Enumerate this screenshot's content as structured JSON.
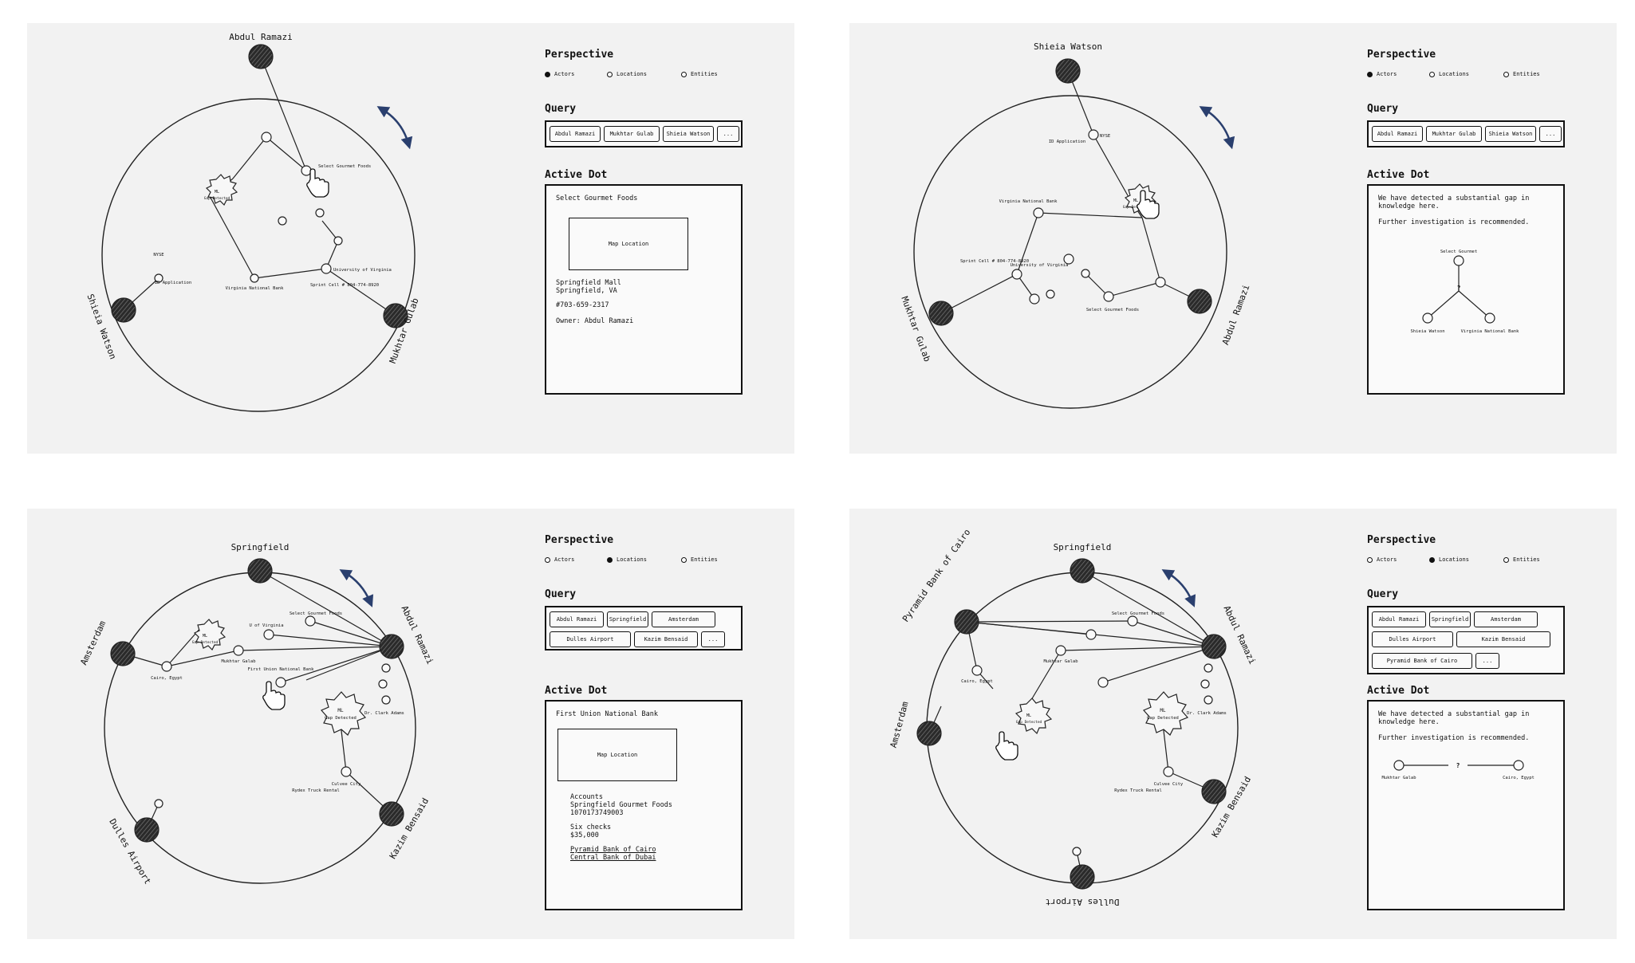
{
  "colors": {
    "panel_bg": "#f2f2f2",
    "ink": "#111111",
    "arrow": "#2a3f6e"
  },
  "labels": {
    "perspective": "Perspective",
    "query": "Query",
    "active_dot": "Active Dot",
    "map_location": "Map Location",
    "question_mark": "?",
    "gap_ml": "ML",
    "gap_text": "Gap Detected",
    "cursor_icon": "hand-pointer-icon"
  },
  "radio_options": [
    "Actors",
    "Locations",
    "Entities"
  ],
  "panels": [
    {
      "selected_perspective": "Actors",
      "query_chips": [
        "Abdul Ramazi",
        "Mukhtar Gulab",
        "Shieia Watson",
        "..."
      ],
      "outer_nodes": [
        "Abdul Ramazi",
        "Mukhtar Gulab",
        "Shieia Watson"
      ],
      "inner_labels": [
        "Select Gourmet Foods",
        "NYSE",
        "ID Application",
        "Virginia National Bank",
        "University of Virginia",
        "Sprint Cell # 804-774-8920"
      ],
      "active": {
        "title": "Select Gourmet Foods",
        "address_1": "Springfield Mall",
        "address_2": "Springfield, VA",
        "phone": "#703-659-2317",
        "owner": "Owner: Abdul Ramazi"
      }
    },
    {
      "selected_perspective": "Actors",
      "query_chips": [
        "Abdul Ramazi",
        "Mukhtar Gulab",
        "Shieia Watson",
        "..."
      ],
      "outer_nodes": [
        "Shieia Watson",
        "Abdul Ramazi",
        "Mukhtar Gulab"
      ],
      "inner_labels": [
        "NYSE",
        "ID Application",
        "Virginia National Bank",
        "Sprint Cell # 804-774-8920",
        "University of Virginia",
        "Select Gourmet Foods"
      ],
      "active": {
        "line_1": "We have detected a substantial gap in knowledge here.",
        "line_2": "Further investigation is recommended.",
        "tree_top": "Select Gourmet",
        "tree_left": "Shieia Watson",
        "tree_right": "Virginia National Bank"
      }
    },
    {
      "selected_perspective": "Locations",
      "query_chips": [
        "Abdul Ramazi",
        "Springfield",
        "Amsterdam",
        "Dulles Airport",
        "Kazim Bensaid",
        "..."
      ],
      "outer_nodes": [
        "Springfield",
        "Amsterdam",
        "Abdul Ramazi",
        "Dulles Airport",
        "Kazim Bensaid"
      ],
      "inner_labels": [
        "Select Gourmet Foods",
        "U of Virginia",
        "Mukhtar Galab",
        "First Union National Bank",
        "Cairo, Egypt",
        "Dr. Clark Adams",
        "Culvee City",
        "Rydex Truck Rental"
      ],
      "active": {
        "title": "First Union National Bank",
        "accounts": "Accounts",
        "acct_name": "Springfield Gourmet Foods",
        "acct_num": "1070173749003",
        "checks": "Six checks",
        "amount": "$35,000",
        "link_1": "Pyramid Bank of Cairo",
        "link_2": "Central Bank of Dubai"
      }
    },
    {
      "selected_perspective": "Locations",
      "query_chips": [
        "Abdul Ramazi",
        "Springfield",
        "Amsterdam",
        "Dulles Airport",
        "Kazim Bensaid",
        "Pyramid Bank of Cairo",
        "..."
      ],
      "outer_nodes": [
        "Springfield",
        "Pyramid Bank of Cairo",
        "Abdul Ramazi",
        "Amsterdam",
        "Kazim Bensaid",
        "Dulles Airport"
      ],
      "inner_labels": [
        "Select Gourmet Foods",
        "Mukhtar Galab",
        "Cairo, Egypt",
        "Dr. Clark Adams",
        "Culvee City",
        "Rydex Truck Rental"
      ],
      "active": {
        "line_1": "We have detected a substantial gap in knowledge here.",
        "line_2": "Further investigation is recommended.",
        "tree_left": "Mukhtar Galab",
        "tree_right": "Cairo, Egypt"
      }
    }
  ]
}
